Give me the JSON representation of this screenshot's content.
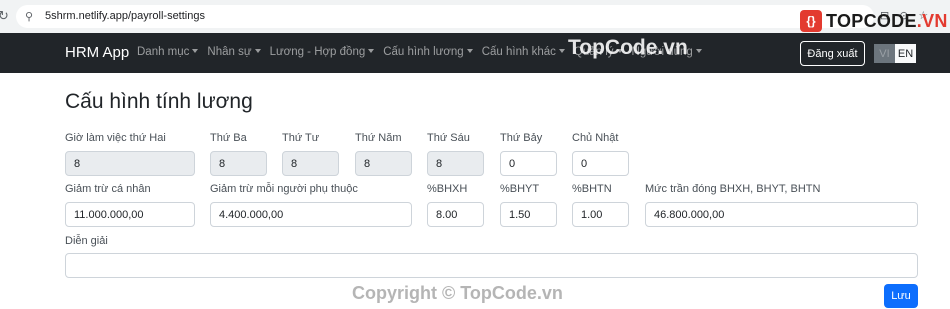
{
  "browser": {
    "url": "5shrm.netlify.app/payroll-settings"
  },
  "watermark": {
    "logo_text": "TOPCODE",
    "logo_suffix": ".VN",
    "nav_text": "TopCode.vn",
    "copyright": "Copyright © TopCode.vn"
  },
  "navbar": {
    "brand": "HRM App",
    "items": [
      "Danh mục",
      "Nhân sự",
      "Lương - Hợp đồng",
      "Cấu hình lương",
      "Cấu hình khác",
      "Quản lý",
      "Người dùng"
    ],
    "logout": "Đăng xuất",
    "lang_vi": "VI",
    "lang_en": "EN"
  },
  "page": {
    "title": "Cấu hình tính lương"
  },
  "form": {
    "hours": {
      "mon_label": "Giờ làm việc thứ Hai",
      "mon": "8",
      "tue_label": "Thứ Ba",
      "tue": "8",
      "wed_label": "Thứ Tư",
      "wed": "8",
      "thu_label": "Thứ Năm",
      "thu": "8",
      "fri_label": "Thứ Sáu",
      "fri": "8",
      "sat_label": "Thứ Bảy",
      "sat": "0",
      "sun_label": "Chủ Nhật",
      "sun": "0"
    },
    "personal_deduction_label": "Giảm trừ cá nhân",
    "personal_deduction": "11.000.000,00",
    "dependent_deduction_label": "Giảm trừ mỗi người phụ thuộc",
    "dependent_deduction": "4.400.000,00",
    "bhxh_label": "%BHXH",
    "bhxh": "8.00",
    "bhyt_label": "%BHYT",
    "bhyt": "1.50",
    "bhtn_label": "%BHTN",
    "bhtn": "1.00",
    "cap_label": "Mức trần đóng BHXH, BHYT, BHTN",
    "cap": "46.800.000,00",
    "note_label": "Diễn giải",
    "note": "",
    "save": "Lưu"
  }
}
